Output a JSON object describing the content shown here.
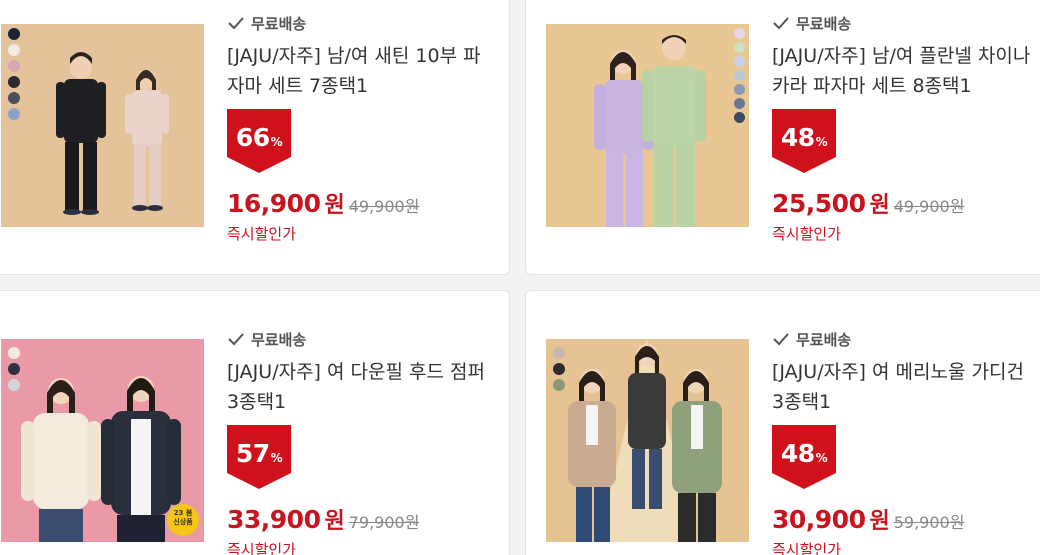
{
  "products": [
    {
      "shipping": "무료배송",
      "title": "[JAJU/자주] 남/여 새틴 10부 파자마 세트 7종택1",
      "discount": "66",
      "discount_unit": "%",
      "price": "16,900",
      "currency": "원",
      "original_price": "49,900원",
      "price_note": "즉시할인가",
      "swatches": [
        "#1c2238",
        "#f2ece6",
        "#d8a6b4",
        "#2a2a2a",
        "#4b4f58",
        "#8aa3c8"
      ],
      "image_bg": "#e4c39b",
      "image_kind": "pajama-satin"
    },
    {
      "shipping": "무료배송",
      "title": "[JAJU/자주] 남/여 플란넬 차이나카라 파자마 세트 8종택1",
      "discount": "48",
      "discount_unit": "%",
      "price": "25,500",
      "currency": "원",
      "original_price": "49,900원",
      "price_note": "즉시할인가",
      "swatches": [
        "#e6d5e6",
        "#cfe0c4",
        "#c9d3e6",
        "#b9cbd8",
        "#8b9ab0",
        "#6c7891",
        "#3f4a63"
      ],
      "image_bg": "#e8c792",
      "image_kind": "pajama-flannel"
    },
    {
      "shipping": "무료배송",
      "title": "[JAJU/자주] 여 다운필 후드 점퍼 3종택1",
      "discount": "57",
      "discount_unit": "%",
      "price": "33,900",
      "currency": "원",
      "original_price": "79,900원",
      "price_note": "즉시할인가",
      "swatches": [
        "#f1ece1",
        "#2d3140",
        "#d7d2d8"
      ],
      "image_bg": "#ea9aa6",
      "image_kind": "jumper",
      "sticker": [
        "23 봄",
        "신상품"
      ]
    },
    {
      "shipping": "무료배송",
      "title": "[JAJU/자주] 여 메리노울 가디건 3종택1",
      "discount": "48",
      "discount_unit": "%",
      "price": "30,900",
      "currency": "원",
      "original_price": "59,900원",
      "price_note": "즉시할인가",
      "swatches": [
        "#c8b8ad",
        "#2d2d2d",
        "#8b9a76"
      ],
      "image_bg": "#e6c392",
      "image_kind": "cardigan"
    }
  ],
  "colors": {
    "accent": "#c8141e",
    "badge": "#d0111b"
  },
  "icons": {
    "shipping": "check-icon"
  }
}
